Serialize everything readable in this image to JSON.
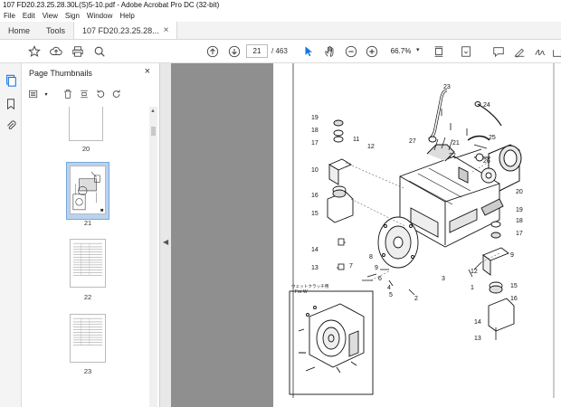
{
  "window": {
    "title": "107 FD20.23.25.28.30L(S)5-10.pdf - Adobe Acrobat Pro DC (32-bit)"
  },
  "menu": [
    "File",
    "Edit",
    "View",
    "Sign",
    "Window",
    "Help"
  ],
  "tabs": {
    "home": "Home",
    "tools": "Tools",
    "document": "107 FD20.23.25.28...",
    "close": "×"
  },
  "toolbar": {
    "current_page": "21",
    "page_count": "/ 463",
    "zoom": "66.7%"
  },
  "panel": {
    "title": "Page Thumbnails",
    "close": "×",
    "thumbnails": [
      {
        "label": "20"
      },
      {
        "label": "21",
        "selected": true
      },
      {
        "label": "22"
      },
      {
        "label": "23"
      }
    ]
  },
  "diagram": {
    "callouts": [
      "23",
      "24",
      "19",
      "18",
      "17",
      "11",
      "12",
      "27",
      "21",
      "25",
      "22",
      "26",
      "10",
      "20",
      "16",
      "15",
      "19",
      "18",
      "17",
      "14",
      "13",
      "7",
      "8",
      "9",
      "6",
      "4",
      "5",
      "2",
      "3",
      "1",
      "12",
      "9",
      "15",
      "16",
      "14",
      "13"
    ],
    "inset_title": "ウェットクラッチ用",
    "inset_subtitle": "For W"
  },
  "colors": {
    "accent": "#1473e6",
    "viewer_bg": "#8f8f8f",
    "selected_thumb": "#b9d2ee"
  },
  "icons": [
    "star-icon",
    "upload-icon",
    "print-icon",
    "search-icon",
    "page-up-icon",
    "page-down-icon",
    "cursor-icon",
    "hand-icon",
    "zoom-out-icon",
    "zoom-in-icon",
    "fit-page-icon",
    "scroll-mode-icon",
    "comment-icon",
    "highlight-icon",
    "sign-icon",
    "share-icon"
  ]
}
